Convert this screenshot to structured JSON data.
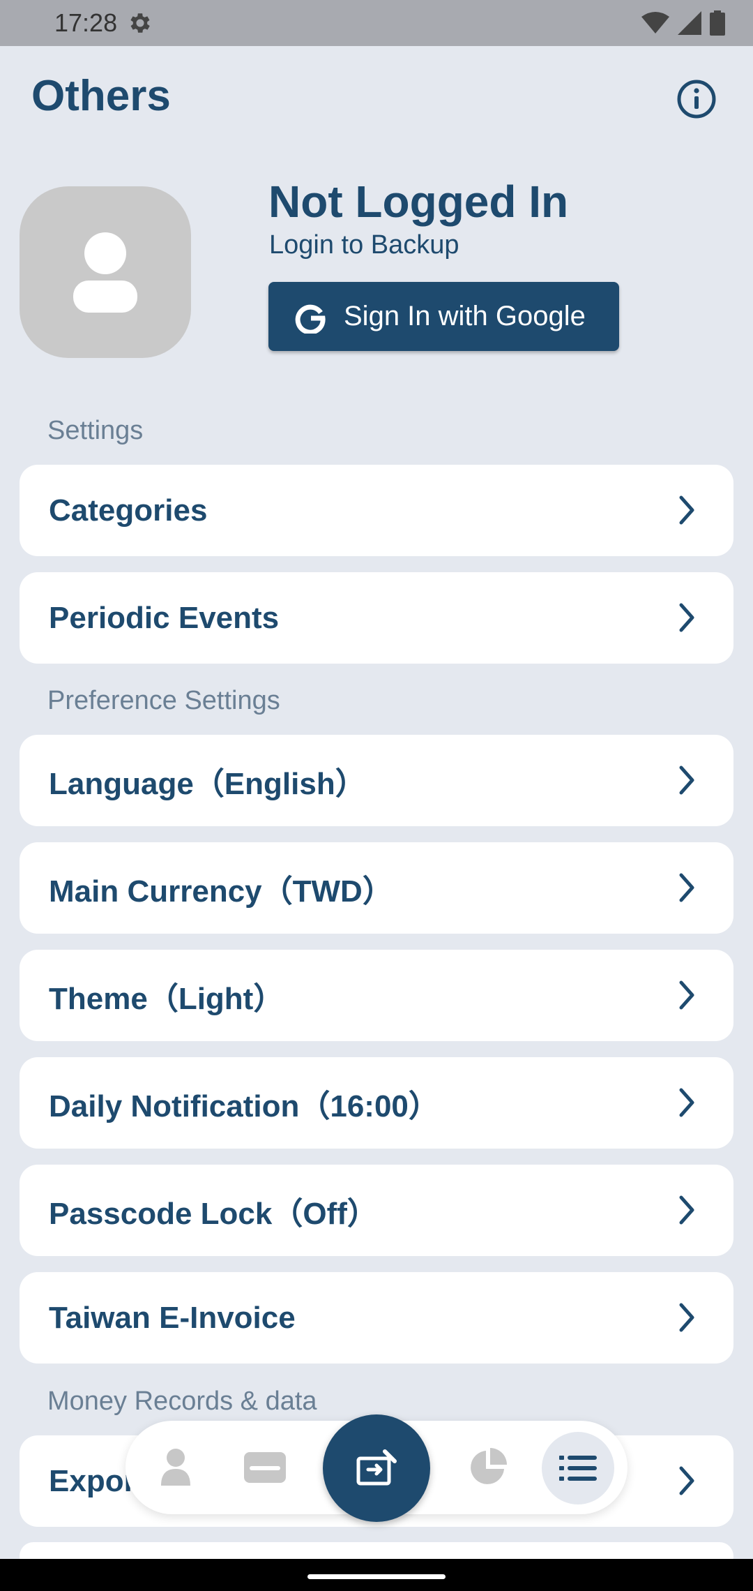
{
  "status_bar": {
    "time": "17:28",
    "icons": [
      "gear-icon",
      "wifi-icon",
      "signal-icon",
      "battery-icon"
    ]
  },
  "header": {
    "title": "Others",
    "info_icon": "info-icon"
  },
  "profile": {
    "title": "Not Logged In",
    "subtitle": "Login to Backup",
    "google_button_label": "Sign In with Google"
  },
  "sections": {
    "settings_label": "Settings",
    "preference_label": "Preference Settings",
    "money_label": "Money Records & data"
  },
  "rows": {
    "categories": "Categories",
    "periodic_events": "Periodic Events",
    "language": "Language（English）",
    "main_currency": "Main Currency（TWD）",
    "theme": "Theme（Light）",
    "daily_notification": "Daily Notification（16:00）",
    "passcode_lock": "Passcode Lock（Off）",
    "taiwan_einvoice": "Taiwan E-Invoice",
    "export_partial": "Expor"
  },
  "bottom_nav": {
    "items": [
      "person-icon",
      "card-icon",
      "add-record-icon",
      "pie-chart-icon",
      "list-icon"
    ],
    "active": "list-icon"
  },
  "colors": {
    "primary": "#1e4a6e",
    "background": "#e4e8ef",
    "card": "#ffffff",
    "section_label": "#6a7f94",
    "avatar_bg": "#c9c9c9"
  }
}
